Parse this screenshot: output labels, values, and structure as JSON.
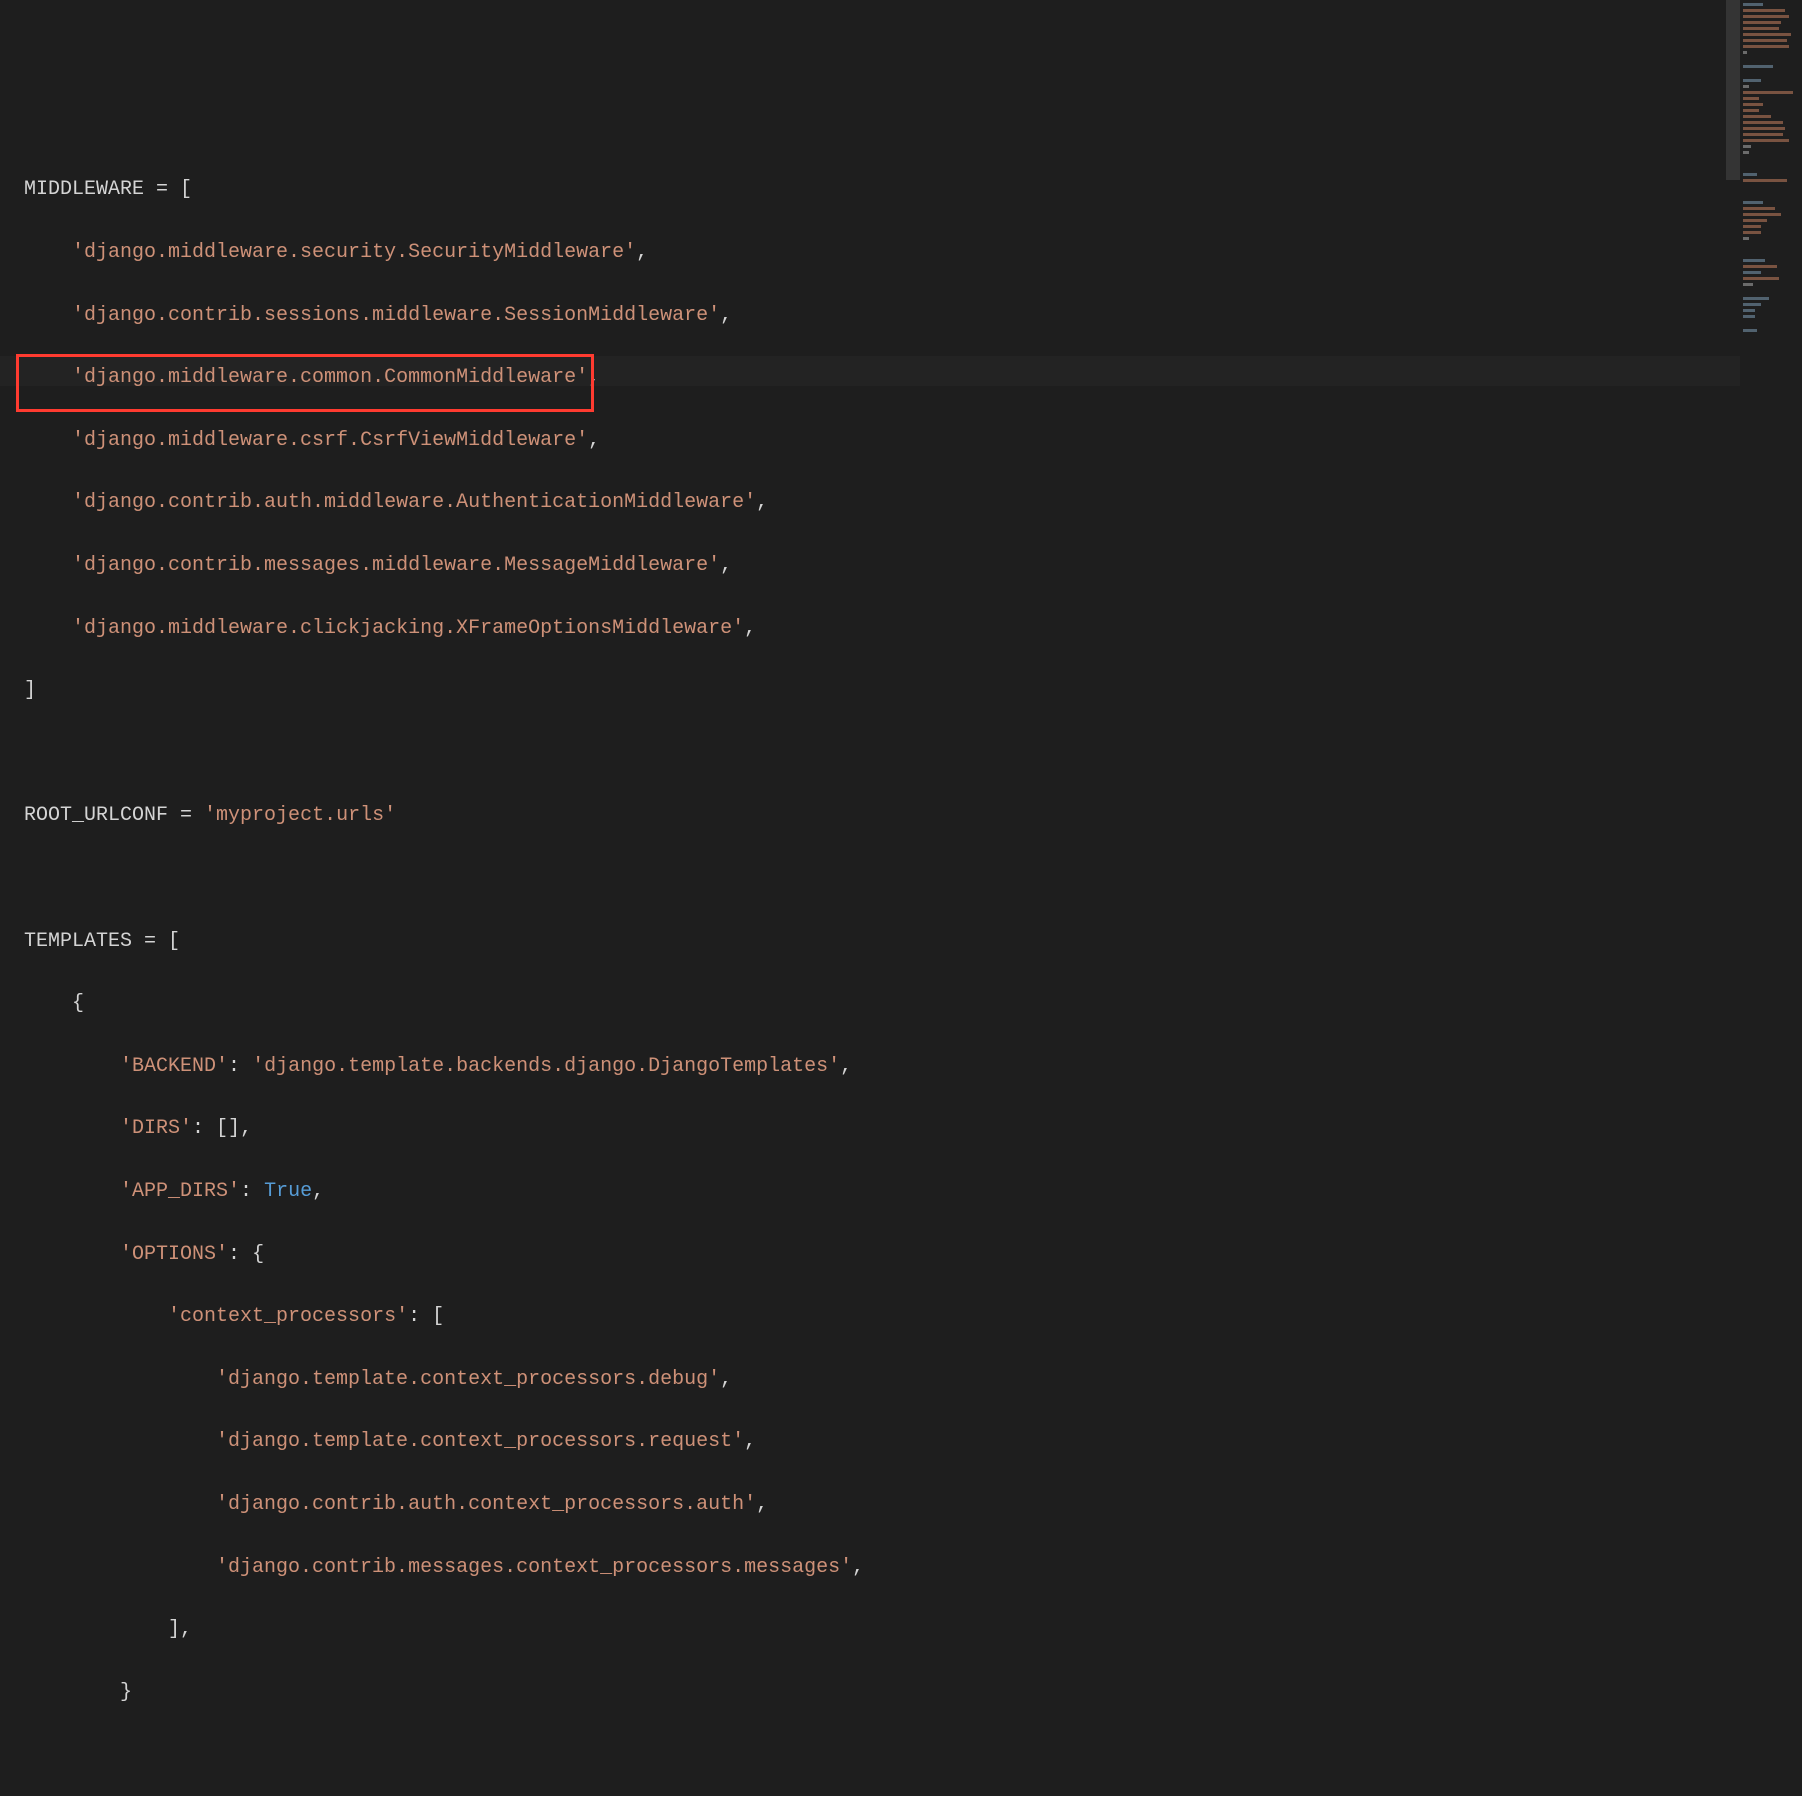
{
  "code": {
    "middleware_key": "MIDDLEWARE",
    "eq": " = ",
    "lbracket": "[",
    "rbracket": "]",
    "comma": ",",
    "middleware_items": [
      "'django.middleware.security.SecurityMiddleware'",
      "'django.contrib.sessions.middleware.SessionMiddleware'",
      "'django.middleware.common.CommonMiddleware'",
      "'django.middleware.csrf.CsrfViewMiddleware'",
      "'django.contrib.auth.middleware.AuthenticationMiddleware'",
      "'django.contrib.messages.middleware.MessageMiddleware'",
      "'django.middleware.clickjacking.XFrameOptionsMiddleware'"
    ],
    "root_urlconf_key": "ROOT_URLCONF",
    "root_urlconf_val": "'myproject.urls'",
    "templates_key": "TEMPLATES",
    "lbrace": "{",
    "rbrace": "}",
    "backend_key": "'BACKEND'",
    "backend_val": "'django.template.backends.django.DjangoTemplates'",
    "dirs_key": "'DIRS'",
    "dirs_val": "[]",
    "app_dirs_key": "'APP_DIRS'",
    "app_dirs_val": "True",
    "options_key": "'OPTIONS'",
    "cp_key": "'context_processors'",
    "cp_items": [
      "'django.template.context_processors.debug'",
      "'django.template.context_processors.request'",
      "'django.contrib.auth.context_processors.auth'",
      "'django.contrib.messages.context_processors.messages'"
    ],
    "closing_bracket_comma": "],"
  },
  "highlight_target": "ROOT_URLCONF line"
}
